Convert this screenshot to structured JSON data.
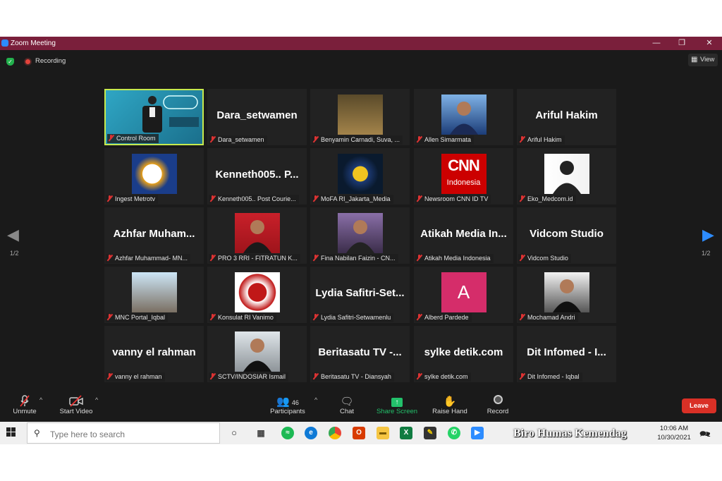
{
  "window": {
    "title": "Zoom Meeting"
  },
  "status": {
    "recording_label": "Recording",
    "view_label": "View"
  },
  "gallery": {
    "page_left": "1/2",
    "page_right": "1/2",
    "tiles": [
      {
        "caption": "Control Room",
        "big": ""
      },
      {
        "caption": "Dara_setwamen",
        "big": "Dara_setwamen"
      },
      {
        "caption": "Benyamin Carnadi, Suva, ...",
        "big": ""
      },
      {
        "caption": "Allen Simarmata",
        "big": ""
      },
      {
        "caption": "Ariful Hakim",
        "big": "Ariful Hakim"
      },
      {
        "caption": "Ingest Metrotv",
        "big": ""
      },
      {
        "caption": "Kenneth005.. Post Courie...",
        "big": "Kenneth005.. P..."
      },
      {
        "caption": "MoFA RI_Jakarta_Media",
        "big": ""
      },
      {
        "caption": "Newsroom CNN ID TV",
        "big": "",
        "logo_top": "CNN",
        "logo_bottom": "Indonesia"
      },
      {
        "caption": "Eko_Medcom.id",
        "big": ""
      },
      {
        "caption": "Azhfar Muhammad- MN...",
        "big": "Azhfar Muham..."
      },
      {
        "caption": "PRO 3 RRI - FITRATUN K...",
        "big": ""
      },
      {
        "caption": "Fina Nabilan Faizin - CN...",
        "big": ""
      },
      {
        "caption": "Atikah Media Indonesia",
        "big": "Atikah Media In..."
      },
      {
        "caption": "Vidcom Studio",
        "big": "Vidcom Studio"
      },
      {
        "caption": "MNC Portal_Iqbal",
        "big": ""
      },
      {
        "caption": "Konsulat RI Vanimo",
        "big": ""
      },
      {
        "caption": "Lydia Safitri-Setwamenlu",
        "big": "Lydia Safitri-Set..."
      },
      {
        "caption": "Alberd Pardede",
        "big": "",
        "avatar_letter": "A"
      },
      {
        "caption": "Mochamad Andri",
        "big": ""
      },
      {
        "caption": "vanny el rahman",
        "big": "vanny el rahman"
      },
      {
        "caption": "SCTV/INDOSIAR Ismail",
        "big": ""
      },
      {
        "caption": "Beritasatu TV - Diansyah",
        "big": "Beritasatu TV -..."
      },
      {
        "caption": "sylke detik.com",
        "big": "sylke detik.com"
      },
      {
        "caption": "Dit Infomed - Iqbal",
        "big": "Dit Infomed - I..."
      }
    ]
  },
  "controls": {
    "unmute": "Unmute",
    "start_video": "Start Video",
    "participants": "Participants",
    "participants_count": "46",
    "chat": "Chat",
    "share_screen": "Share Screen",
    "raise_hand": "Raise Hand",
    "record": "Record",
    "leave": "Leave"
  },
  "taskbar": {
    "search_placeholder": "Type here to search",
    "time": "10:06 AM",
    "date": "10/30/2021",
    "notification_count": "2"
  },
  "watermark": "Biro Humas Kemendag",
  "colors": {
    "titlebar": "#7a1f3b",
    "active_speaker": "#c6ea4e",
    "leave": "#d93026",
    "share": "#23c16b"
  }
}
